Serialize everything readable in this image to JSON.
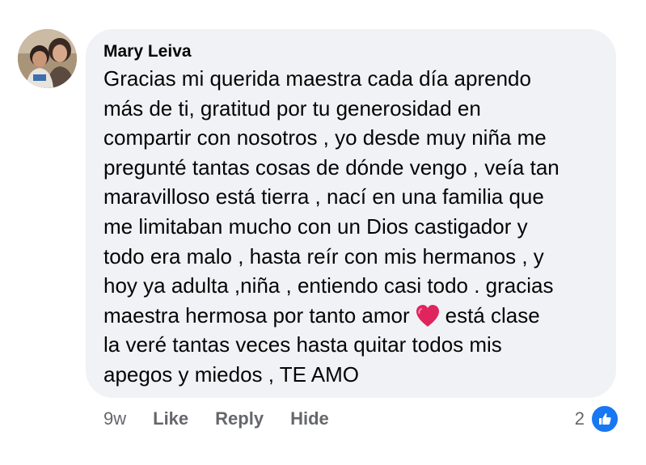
{
  "comment": {
    "author": "Mary Leiva",
    "lines": [
      "Gracias mi querida maestra cada día aprendo",
      "más de ti, gratitud por tu generosidad en",
      "compartir con nosotros , yo desde muy niña me",
      "pregunté tantas cosas de dónde vengo , veía tan",
      "maravilloso está tierra , nací en una familia que",
      "me limitaban mucho con un Dios castigador y",
      "todo era malo , hasta reír con mis hermanos , y",
      "hoy ya adulta ,niña , entiendo casi todo . gracias",
      "maestra hermosa por tanto amor",
      "está clase",
      "la veré tantas veces hasta quitar todos mis",
      "apegos y miedos , TE AMO"
    ],
    "emoji": "red-heart"
  },
  "actions": {
    "time": "9w",
    "like": "Like",
    "reply": "Reply",
    "hide": "Hide"
  },
  "reactions": {
    "count": "2",
    "icon": "like-thumb-icon",
    "color": "#1877f2"
  },
  "colors": {
    "bubble": "#f0f2f5",
    "text": "#050505",
    "secondary_text": "#65676b",
    "heart": "#e0245e"
  }
}
